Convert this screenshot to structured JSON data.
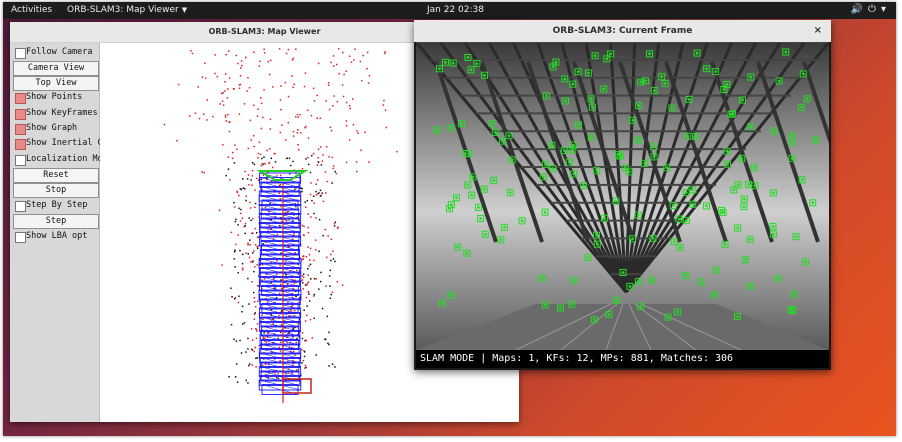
{
  "topbar": {
    "activities": "Activities",
    "app_menu": "ORB-SLAM3: Map Viewer",
    "clock": "Jan 22  02:38",
    "volume_icon": "volume-icon",
    "power_icon": "power-icon",
    "caret_icon": "chevron-down-icon"
  },
  "map_viewer": {
    "title": "ORB-SLAM3: Map Viewer",
    "controls": [
      {
        "label": "Follow Camera",
        "type": "checkbox",
        "checked": false
      },
      {
        "label": "Camera View",
        "type": "button"
      },
      {
        "label": "Top View",
        "type": "button"
      },
      {
        "label": "Show Points",
        "type": "checkbox",
        "checked": true
      },
      {
        "label": "Show KeyFrames",
        "type": "checkbox",
        "checked": true
      },
      {
        "label": "Show Graph",
        "type": "checkbox",
        "checked": true
      },
      {
        "label": "Show Inertial Graph",
        "type": "checkbox",
        "checked": true
      },
      {
        "label": "Localization Mode",
        "type": "checkbox",
        "checked": false
      },
      {
        "label": "Reset",
        "type": "button"
      },
      {
        "label": "Stop",
        "type": "button"
      },
      {
        "label": "Step By Step",
        "type": "checkbox",
        "checked": false
      },
      {
        "label": "Step",
        "type": "button"
      },
      {
        "label": "Show LBA opt",
        "type": "checkbox",
        "checked": false
      }
    ],
    "colors": {
      "map_points": "#e02020",
      "ref_points": "#111111",
      "keyframes": "#1a1aff",
      "current": "#22cc22",
      "trajectory": "#cc2020"
    }
  },
  "current_frame": {
    "title": "ORB-SLAM3: Current Frame",
    "close_label": "×",
    "status": "SLAM MODE |  Maps: 1, KFs: 12, MPs: 881, Matches: 306",
    "feature_color": "#22dd22"
  }
}
